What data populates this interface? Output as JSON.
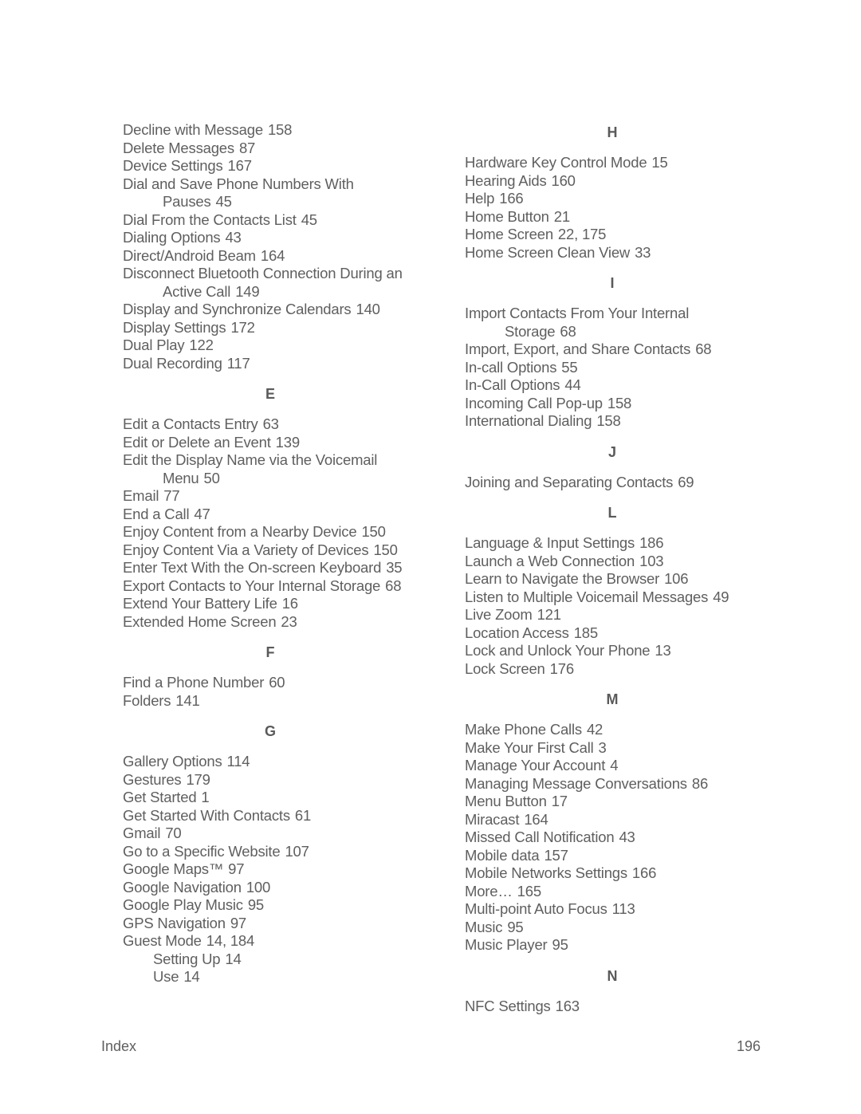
{
  "left_column": {
    "D_entries": [
      {
        "term": "Decline with Message",
        "pages": "158"
      },
      {
        "term": "Delete Messages",
        "pages": "87"
      },
      {
        "term": "Device Settings",
        "pages": "167"
      },
      {
        "term": "Dial and Save Phone Numbers With",
        "cont": "Pauses",
        "pages": "45"
      },
      {
        "term": "Dial From the Contacts List",
        "pages": "45"
      },
      {
        "term": "Dialing Options",
        "pages": "43"
      },
      {
        "term": "Direct/Android Beam",
        "pages": "164"
      },
      {
        "term": "Disconnect Bluetooth Connection During an",
        "cont": "Active Call",
        "pages": "149"
      },
      {
        "term": "Display and Synchronize Calendars",
        "pages": "140"
      },
      {
        "term": "Display Settings",
        "pages": "172"
      },
      {
        "term": "Dual Play",
        "pages": "122"
      },
      {
        "term": "Dual Recording",
        "pages": "117"
      }
    ],
    "E_letter": "E",
    "E_entries": [
      {
        "term": "Edit a Contacts Entry",
        "pages": "63"
      },
      {
        "term": "Edit or Delete an Event",
        "pages": "139"
      },
      {
        "term": "Edit the Display Name via the Voicemail",
        "cont": "Menu",
        "pages": "50"
      },
      {
        "term": "Email",
        "pages": "77"
      },
      {
        "term": "End a Call",
        "pages": "47"
      },
      {
        "term": "Enjoy Content from a Nearby Device",
        "pages": "150"
      },
      {
        "term": "Enjoy Content Via a Variety of Devices",
        "pages": "150"
      },
      {
        "term": "Enter Text With the On-screen Keyboard",
        "pages": "35"
      },
      {
        "term": "Export Contacts to Your Internal Storage",
        "pages": "68"
      },
      {
        "term": "Extend Your Battery Life",
        "pages": "16"
      },
      {
        "term": "Extended Home Screen",
        "pages": "23"
      }
    ],
    "F_letter": "F",
    "F_entries": [
      {
        "term": "Find a Phone Number",
        "pages": "60"
      },
      {
        "term": "Folders",
        "pages": "141"
      }
    ],
    "G_letter": "G",
    "G_entries": [
      {
        "term": "Gallery Options",
        "pages": "114"
      },
      {
        "term": "Gestures",
        "pages": "179"
      },
      {
        "term": "Get Started",
        "pages": "1"
      },
      {
        "term": "Get Started With Contacts",
        "pages": "61"
      },
      {
        "term": "Gmail",
        "pages": "70"
      },
      {
        "term": "Go to a Specific Website",
        "pages": "107"
      },
      {
        "term": "Google Maps™",
        "pages": "97"
      },
      {
        "term": "Google Navigation",
        "pages": "100"
      },
      {
        "term": "Google Play Music",
        "pages": "95"
      },
      {
        "term": "GPS Navigation",
        "pages": "97"
      },
      {
        "term": "Guest Mode",
        "pages": "14, 184"
      },
      {
        "term": "Setting Up",
        "pages": "14",
        "sub": true
      },
      {
        "term": "Use",
        "pages": "14",
        "sub": true
      }
    ]
  },
  "right_column": {
    "H_letter": "H",
    "H_entries": [
      {
        "term": "Hardware Key Control Mode",
        "pages": "15"
      },
      {
        "term": "Hearing Aids",
        "pages": "160"
      },
      {
        "term": "Help",
        "pages": "166"
      },
      {
        "term": "Home Button",
        "pages": "21"
      },
      {
        "term": "Home Screen",
        "pages": "22, 175"
      },
      {
        "term": "Home Screen Clean View",
        "pages": "33"
      }
    ],
    "I_letter": "I",
    "I_entries": [
      {
        "term": "Import Contacts From Your Internal",
        "cont": "Storage",
        "pages": "68"
      },
      {
        "term": "Import, Export, and Share Contacts",
        "pages": "68"
      },
      {
        "term": "In-call Options",
        "pages": "55"
      },
      {
        "term": "In-Call Options",
        "pages": "44"
      },
      {
        "term": "Incoming Call Pop-up",
        "pages": "158"
      },
      {
        "term": "International Dialing",
        "pages": "158"
      }
    ],
    "J_letter": "J",
    "J_entries": [
      {
        "term": "Joining and Separating Contacts",
        "pages": "69"
      }
    ],
    "L_letter": "L",
    "L_entries": [
      {
        "term": "Language & Input Settings",
        "pages": "186"
      },
      {
        "term": "Launch a Web Connection",
        "pages": "103"
      },
      {
        "term": "Learn to Navigate the Browser",
        "pages": "106"
      },
      {
        "term": "Listen to Multiple Voicemail Messages",
        "pages": "49"
      },
      {
        "term": "Live Zoom",
        "pages": "121"
      },
      {
        "term": "Location Access",
        "pages": "185"
      },
      {
        "term": "Lock and Unlock Your Phone",
        "pages": "13"
      },
      {
        "term": "Lock Screen",
        "pages": "176"
      }
    ],
    "M_letter": "M",
    "M_entries": [
      {
        "term": "Make Phone Calls",
        "pages": "42"
      },
      {
        "term": "Make Your First Call",
        "pages": "3"
      },
      {
        "term": "Manage Your Account",
        "pages": "4"
      },
      {
        "term": "Managing Message Conversations",
        "pages": "86"
      },
      {
        "term": "Menu Button",
        "pages": "17"
      },
      {
        "term": "Miracast",
        "pages": "164"
      },
      {
        "term": "Missed Call Notification",
        "pages": "43"
      },
      {
        "term": "Mobile data",
        "pages": "157"
      },
      {
        "term": "Mobile Networks Settings",
        "pages": "166"
      },
      {
        "term": "More…",
        "pages": "165"
      },
      {
        "term": "Multi-point Auto Focus",
        "pages": "113"
      },
      {
        "term": "Music",
        "pages": "95"
      },
      {
        "term": "Music Player",
        "pages": "95"
      }
    ],
    "N_letter": "N",
    "N_entries": [
      {
        "term": "NFC Settings",
        "pages": "163"
      }
    ]
  },
  "footer": {
    "section": "Index",
    "page_number": "196"
  }
}
